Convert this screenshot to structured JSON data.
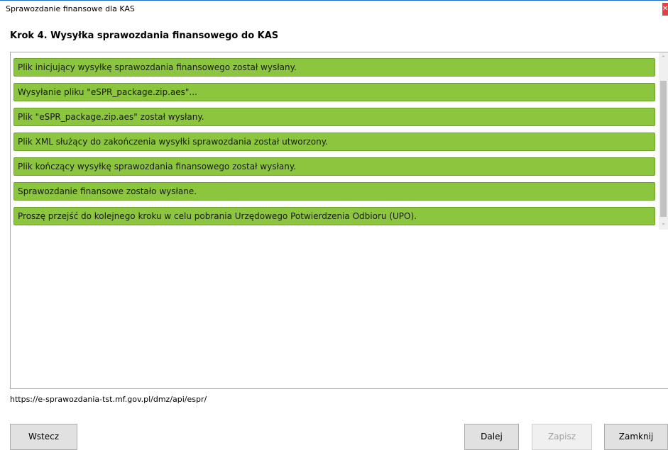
{
  "window": {
    "title": "Sprawozdanie finansowe dla KAS",
    "close_glyph": "✕"
  },
  "step_heading": "Krok 4. Wysyłka sprawozdania finansowego do KAS",
  "log": {
    "item_color": "#8cc63e",
    "items": [
      "Plik inicjujący wysyłkę sprawozdania finansowego został wysłany.",
      "Wysyłanie pliku \"eSPR_package.zip.aes\"...",
      "Plik \"eSPR_package.zip.aes\" został wysłany.",
      "Plik XML służący do zakończenia wysyłki sprawozdania został utworzony.",
      "Plik kończący wysyłkę sprawozdania finansowego został wysłany.",
      "Sprawozdanie finansowe zostało wysłane.",
      "Proszę przejść do kolejnego kroku w celu pobrania Urzędowego Potwierdzenia Odbioru (UPO)."
    ]
  },
  "url": "https://e-sprawozdania-tst.mf.gov.pl/dmz/api/espr/",
  "buttons": {
    "back": "Wstecz",
    "next": "Dalej",
    "save": "Zapisz",
    "close": "Zamknij"
  }
}
